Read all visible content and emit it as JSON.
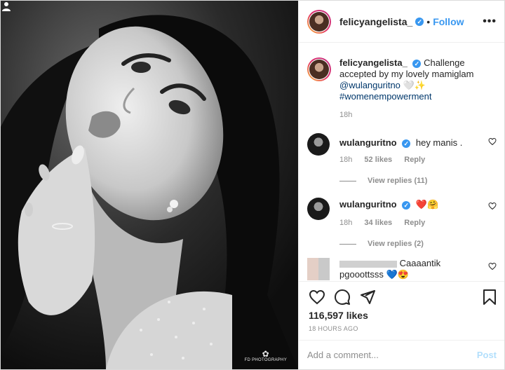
{
  "post": {
    "photo_credit": "FD PHOTOGRAPHY",
    "author": "felicyangelista_",
    "follow_label": "Follow",
    "more_label": "•••",
    "separator": "•"
  },
  "caption": {
    "username": "felicyangelista_",
    "text": "Challenge accepted by my lovely mamiglam",
    "mention": "@wulanguritno",
    "emoji": "🤍✨",
    "hashtag": "#womenempowerment",
    "time": "18h"
  },
  "comments": [
    {
      "username": "wulanguritno",
      "text": "hey manis .",
      "time": "18h",
      "likes": "52 likes",
      "reply": "Reply",
      "replies": "View replies (11)"
    },
    {
      "username": "wulanguritno",
      "text": "❤️🤗",
      "time": "18h",
      "likes": "34 likes",
      "reply": "Reply",
      "replies": "View replies (2)"
    },
    {
      "username": "",
      "text": "Caaaantik",
      "text2": "pgooottsss 💙😍"
    }
  ],
  "stats": {
    "likes": "116,597 likes",
    "timestamp": "18 HOURS AGO"
  },
  "composer": {
    "placeholder": "Add a comment...",
    "post_label": "Post"
  },
  "colors": {
    "accent": "#3897f0",
    "verified": "#3897f0",
    "link": "#00376b"
  },
  "icons": [
    "heart-icon",
    "comment-icon",
    "share-icon",
    "bookmark-icon",
    "user-tag-icon",
    "more-icon",
    "verified-icon"
  ]
}
